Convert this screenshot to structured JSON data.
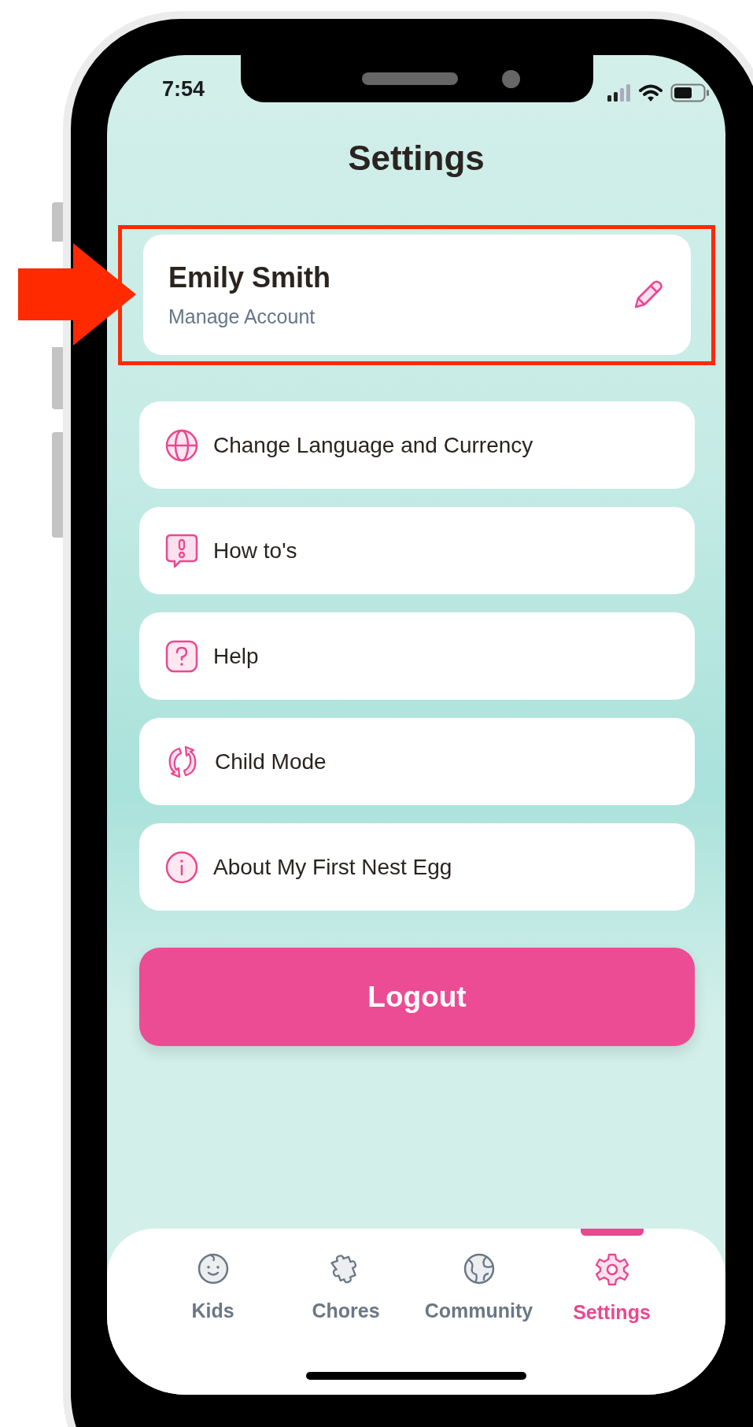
{
  "status_bar": {
    "time": "7:54"
  },
  "header": {
    "title": "Settings"
  },
  "profile": {
    "name": "Emily Smith",
    "subtitle": "Manage Account",
    "highlighted": true
  },
  "menu": [
    {
      "label": "Change Language and Currency",
      "kind": "globe"
    },
    {
      "label": "How to's",
      "kind": "tips"
    },
    {
      "label": "Help",
      "kind": "help"
    },
    {
      "label": "Child Mode",
      "kind": "switch"
    },
    {
      "label": "About My First Nest Egg",
      "kind": "info"
    }
  ],
  "logout": {
    "label": "Logout"
  },
  "tabs": [
    {
      "label": "Kids",
      "kind": "face",
      "selected": false
    },
    {
      "label": "Chores",
      "kind": "puzzle",
      "selected": false
    },
    {
      "label": "Community",
      "kind": "earth",
      "selected": false
    },
    {
      "label": "Settings",
      "kind": "gear",
      "selected": true
    }
  ]
}
